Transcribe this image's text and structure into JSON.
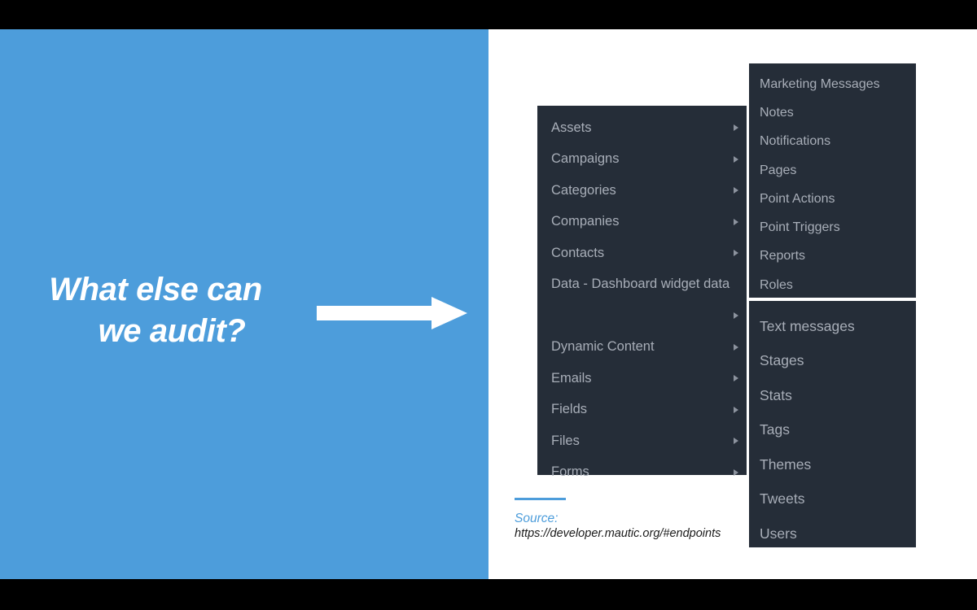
{
  "slide": {
    "headline_line_1": "What else can",
    "headline_line_2": "we audit?",
    "arrow_icon": "right-arrow-icon"
  },
  "colors": {
    "accent_blue": "#4d9ddb",
    "menu_background": "#252d38",
    "menu_text": "#a8aeb8",
    "letterbox": "#000000",
    "canvas": "#ffffff"
  },
  "menu": {
    "panel_1": {
      "items": [
        {
          "label": "Assets",
          "has_submenu": true
        },
        {
          "label": "Campaigns",
          "has_submenu": true
        },
        {
          "label": "Categories",
          "has_submenu": true
        },
        {
          "label": "Companies",
          "has_submenu": true
        },
        {
          "label": "Contacts",
          "has_submenu": true
        },
        {
          "label": "Data - Dashboard widget data",
          "has_submenu": false
        },
        {
          "label": "",
          "has_submenu": true
        },
        {
          "label": "Dynamic Content",
          "has_submenu": true
        },
        {
          "label": "Emails",
          "has_submenu": true
        },
        {
          "label": "Fields",
          "has_submenu": true
        },
        {
          "label": "Files",
          "has_submenu": true
        },
        {
          "label": "Forms",
          "has_submenu": true
        }
      ]
    },
    "panel_2": {
      "items": [
        {
          "label": "Marketing Messages"
        },
        {
          "label": "Notes"
        },
        {
          "label": "Notifications"
        },
        {
          "label": "Pages"
        },
        {
          "label": "Point Actions"
        },
        {
          "label": "Point Triggers"
        },
        {
          "label": "Reports"
        },
        {
          "label": "Roles"
        }
      ]
    },
    "panel_3": {
      "items": [
        {
          "label": "Text messages"
        },
        {
          "label": "Stages"
        },
        {
          "label": "Stats"
        },
        {
          "label": "Tags"
        },
        {
          "label": "Themes"
        },
        {
          "label": "Tweets"
        },
        {
          "label": "Users"
        }
      ]
    }
  },
  "source": {
    "label": "Source:",
    "url": "https://developer.mautic.org/#endpoints"
  }
}
